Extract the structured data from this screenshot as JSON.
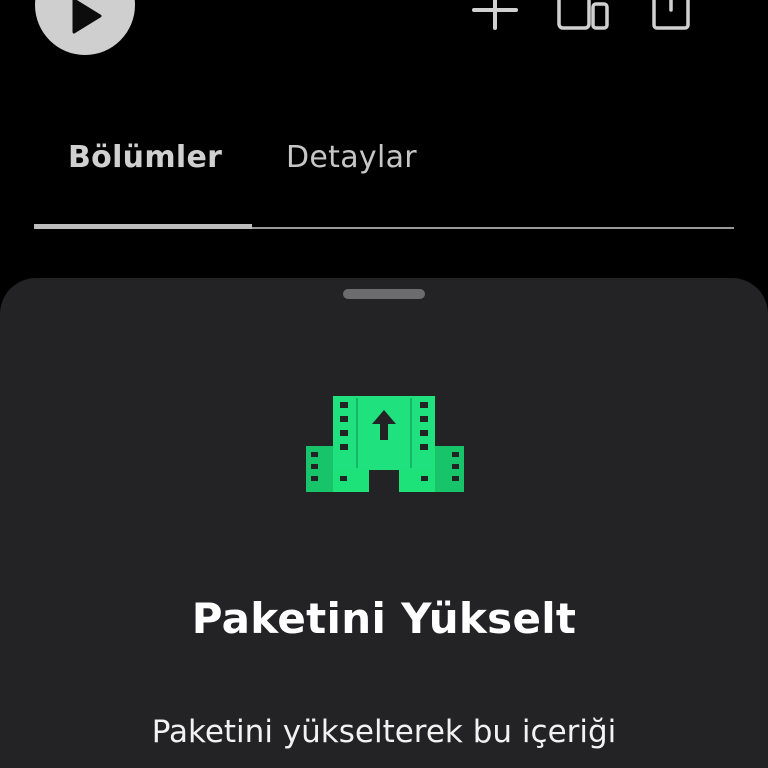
{
  "tabs": {
    "items": [
      {
        "label": "Bölümler",
        "active": true
      },
      {
        "label": "Detaylar",
        "active": false
      }
    ]
  },
  "sheet": {
    "title": "Paketini Yükselt",
    "description": "Paketini yükselterek bu içeriği"
  },
  "icons": {
    "play": "play-icon",
    "add": "plus-icon",
    "cast": "cast-icon",
    "share": "share-icon",
    "upgrade": "film-upgrade-icon"
  },
  "colors": {
    "background": "#000000",
    "sheet": "#232325",
    "accent": "#1de27a",
    "text": "#ffffff"
  }
}
